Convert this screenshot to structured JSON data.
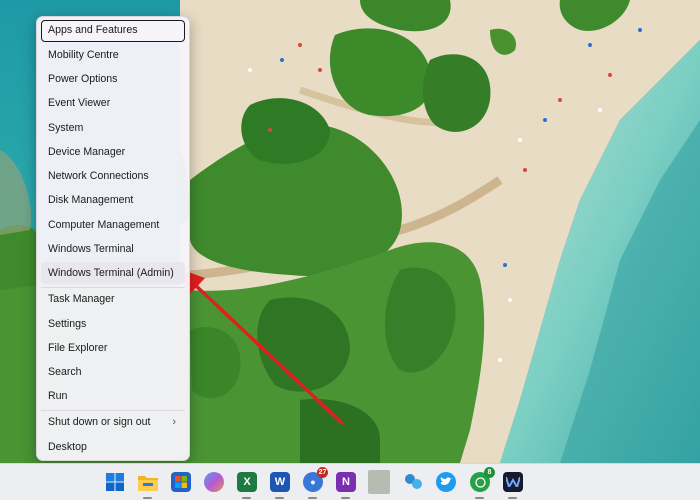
{
  "context_menu": {
    "items": [
      {
        "label": "Apps and Features",
        "interactable": true
      },
      {
        "label": "Mobility Centre",
        "interactable": true
      },
      {
        "label": "Power Options",
        "interactable": true
      },
      {
        "label": "Event Viewer",
        "interactable": true
      },
      {
        "label": "System",
        "interactable": true
      },
      {
        "label": "Device Manager",
        "interactable": true
      },
      {
        "label": "Network Connections",
        "interactable": true
      },
      {
        "label": "Disk Management",
        "interactable": true
      },
      {
        "label": "Computer Management",
        "interactable": true
      },
      {
        "label": "Windows Terminal",
        "interactable": true
      },
      {
        "label": "Windows Terminal (Admin)",
        "interactable": true
      },
      {
        "label": "Task Manager",
        "interactable": true
      },
      {
        "label": "Settings",
        "interactable": true
      },
      {
        "label": "File Explorer",
        "interactable": true
      },
      {
        "label": "Search",
        "interactable": true
      },
      {
        "label": "Run",
        "interactable": true
      },
      {
        "label": "Shut down or sign out",
        "interactable": true,
        "submenu_icon": "chevron-right-icon"
      },
      {
        "label": "Desktop",
        "interactable": true
      }
    ],
    "focused_item": "Apps and Features",
    "highlighted_item": "Windows Terminal (Admin)"
  },
  "annotation": {
    "type": "arrow",
    "color": "#e02020",
    "points_to": "Windows Terminal (Admin)"
  },
  "taskbar": {
    "icons": [
      {
        "name": "start-icon",
        "color": "#0a6fd6"
      },
      {
        "name": "file-explorer-icon",
        "color": "#f3b422"
      },
      {
        "name": "microsoft-store-icon",
        "color": "#2363c9"
      },
      {
        "name": "copilot-icon",
        "color": "#8a5ad6"
      },
      {
        "name": "excel-icon",
        "color": "#1d7a43",
        "glyph": "X"
      },
      {
        "name": "word-icon",
        "color": "#2056b3",
        "glyph": "W"
      },
      {
        "name": "chat-icon",
        "color": "#3a78d8",
        "badge": "27",
        "badge_color": "#c42b1c"
      },
      {
        "name": "onenote-icon",
        "color": "#7b2fb0",
        "glyph": "N"
      },
      {
        "name": "blank-app-icon",
        "color": "#b7bcb3"
      },
      {
        "name": "people-icon",
        "color": "#2f8bd0"
      },
      {
        "name": "twitter-icon",
        "color": "#1d9bf0"
      },
      {
        "name": "whatsapp-icon",
        "color": "#25a244",
        "badge": "8",
        "badge_color": "#1f8f3c"
      },
      {
        "name": "app-icon",
        "color": "#1a1a2e"
      }
    ]
  }
}
